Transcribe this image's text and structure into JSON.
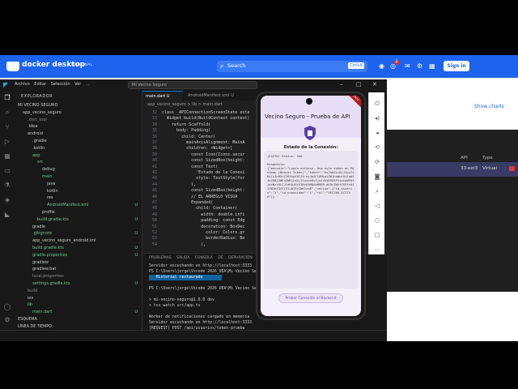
{
  "docker": {
    "title": "docker desktop",
    "badge": "PERSONAL",
    "search_placeholder": "Search",
    "search_shortcut": "Ctrl+K",
    "notification_count": "2",
    "signin_label": "Sign in",
    "show_charts": "Show charts",
    "device_columns": [
      "API",
      "Type"
    ],
    "device_row": {
      "api": "33-ext3",
      "type": "Virtual"
    }
  },
  "vscode": {
    "menu": [
      "Archivo",
      "Editar",
      "Selección",
      "Ver",
      "..."
    ],
    "search_text": "Mi Vecino Seguro",
    "explorer_title": "EXPLORADOR",
    "tree": [
      {
        "label": "MI VECINO SEGURO",
        "indent": 0,
        "badge": "",
        "color": "#cccccc"
      },
      {
        "label": "app_vecino_seguro",
        "indent": 1,
        "badge": "",
        "color": "#cccccc"
      },
      {
        "label": ".dart_tool",
        "indent": 2,
        "badge": "",
        "color": "#8a8a8a"
      },
      {
        "label": ".idea",
        "indent": 2,
        "badge": "",
        "color": "#cccccc"
      },
      {
        "label": "android",
        "indent": 2,
        "badge": "",
        "color": "#cccccc"
      },
      {
        "label": ".gradle",
        "indent": 3,
        "badge": "",
        "color": "#cccccc"
      },
      {
        "label": ".kotlin",
        "indent": 3,
        "badge": "",
        "color": "#cccccc"
      },
      {
        "label": "app",
        "indent": 3,
        "badge": "",
        "color": "#73c991"
      },
      {
        "label": "src",
        "indent": 4,
        "badge": "",
        "color": "#73c991"
      },
      {
        "label": "debug",
        "indent": 5,
        "badge": "",
        "color": "#cccccc"
      },
      {
        "label": "main",
        "indent": 5,
        "badge": "",
        "color": "#73c991"
      },
      {
        "label": "java",
        "indent": 6,
        "badge": "",
        "color": "#cccccc"
      },
      {
        "label": "kotlin",
        "indent": 6,
        "badge": "",
        "color": "#cccccc"
      },
      {
        "label": "res",
        "indent": 6,
        "badge": "",
        "color": "#cccccc"
      },
      {
        "label": "AndroidManifest.xml",
        "indent": 6,
        "badge": "U",
        "color": "#73c991"
      },
      {
        "label": "profile",
        "indent": 5,
        "badge": "",
        "color": "#cccccc"
      },
      {
        "label": "build.gradle.kts",
        "indent": 4,
        "badge": "U",
        "color": "#73c991"
      },
      {
        "label": "gradle",
        "indent": 3,
        "badge": "",
        "color": "#cccccc"
      },
      {
        "label": ".gitignore",
        "indent": 3,
        "badge": "U",
        "color": "#73c991"
      },
      {
        "label": "app_vecino_seguro_android.iml",
        "indent": 3,
        "badge": "",
        "color": "#cccccc"
      },
      {
        "label": "build.gradle.kts",
        "indent": 3,
        "badge": "U",
        "color": "#73c991"
      },
      {
        "label": "gradle.properties",
        "indent": 3,
        "badge": "U",
        "color": "#73c991"
      },
      {
        "label": "gradlew",
        "indent": 3,
        "badge": "",
        "color": "#cccccc"
      },
      {
        "label": "gradlew.bat",
        "indent": 3,
        "badge": "",
        "color": "#cccccc"
      },
      {
        "label": "local.properties",
        "indent": 3,
        "badge": "",
        "color": "#8a8a8a"
      },
      {
        "label": "settings.gradle.kts",
        "indent": 3,
        "badge": "U",
        "color": "#73c991"
      },
      {
        "label": "build",
        "indent": 2,
        "badge": "",
        "color": "#8a8a8a"
      },
      {
        "label": "ios",
        "indent": 2,
        "badge": "",
        "color": "#cccccc"
      },
      {
        "label": "lib",
        "indent": 2,
        "badge": "",
        "color": "#73c991"
      },
      {
        "label": "main.dart",
        "indent": 3,
        "badge": "U",
        "color": "#73c991"
      }
    ],
    "outline_label": "ESQUEMA",
    "timeline_label": "LÍNEA DE TIEMPO",
    "tabs": [
      {
        "label": "main.dart U",
        "active": true
      },
      {
        "label": "AndroidManifest.xml U",
        "active": false
      }
    ],
    "breadcrumb": "app_vecino_seguro > lib > main.dart",
    "code": [
      {
        "n": "32",
        "t": "class _APIConnectionScreenState exte"
      },
      {
        "n": "33",
        "t": "  Widget build(BuildContext context)"
      },
      {
        "n": "34",
        "t": "    return Scaffold("
      },
      {
        "n": "35",
        "t": "      body: Padding("
      },
      {
        "n": "36",
        "t": "        child: Center("
      },
      {
        "n": "37",
        "t": "          mainAxisAlignment: MainA"
      },
      {
        "n": "38",
        "t": "          children: <Widget>["
      },
      {
        "n": "39",
        "t": "            const Icon(Icons.secur"
      },
      {
        "n": "40",
        "t": "            const SizedBox(height:"
      },
      {
        "n": "41",
        "t": "            const Text("
      },
      {
        "n": "42",
        "t": "              'Estado de la Conexi"
      },
      {
        "n": "43",
        "t": "              style: TextStyle(for"
      },
      {
        "n": "44",
        "t": "            ),"
      },
      {
        "n": "45",
        "t": "            const SizedBox(height:"
      },
      {
        "n": "46",
        "t": "            // EL ARREGLO VISUA"
      },
      {
        "n": "47",
        "t": "            Expanded("
      },
      {
        "n": "48",
        "t": "              child: Container("
      },
      {
        "n": "49",
        "t": "                width: double.infi"
      },
      {
        "n": "50",
        "t": "                padding: const Edg"
      },
      {
        "n": "51",
        "t": "                decoration: BoxDec"
      },
      {
        "n": "52",
        "t": "                  color: Colors.gr"
      },
      {
        "n": "53",
        "t": "                  borderRadius: Bo"
      },
      {
        "n": "54",
        "t": "                ),"
      }
    ],
    "panel_tabs": [
      "PROBLEMAS",
      "SALIDA",
      "CONSOLA DE DEPURACIÓN",
      "TERMINAL"
    ],
    "terminal": [
      "Servidor escuchando en http://localhost:3333",
      "PS C:\\Users\\jorge\\Vscode 2026_UEA\\Mi Vecino Seg",
      "   Historial restaurado",
      "",
      "PS C:\\Users\\jorge\\Vscode 2026_UEA\\Mi Vecino Seg",
      "",
      "> mi-vecino-seguro@1.0.0 dev",
      "> tsx watch src/app.ts",
      "",
      "Worker de notificaciones cargado en memoria",
      "Servidor escuchando en http://localhost:3333",
      "[REQUEST] POST /api/usuarios/token-prueba"
    ]
  },
  "emulator": {
    "app_title": "Vecino Seguro - Prueba de API",
    "debug_banner": "DEBUG",
    "heading": "Estado de la Conexión:",
    "status_line": "¡ÉXITO! Status: 200",
    "response_label": "Respuesta:",
    "response_body": "{\"mensaje\":\"Login exitoso. Usa este token en Postman (Bearer Token)\",\"token\":\"eyJhbGciOiJIUzI1NiIsInR5cCI6IkpXVCJ9.eyJpZCI6MiwiZW1haWwiOiJqb3JnZUB1ZWEuZWR1LmVjIiwicm9sIjoiVkVDSU5PIiwiaWF0IjoxNzY0LCJleHAiOjE3NzE0MDAwMDB9.dG9rZW5fZGVfcHJ1ZWJhX3ZlY2lub19zZWd1cm8\",\"vecino\":{\"id_usuario\":\"2\",\"id_comunidad\":\"1\",\"rol\":\"VECINO_ACTIVO\"}}",
    "button_label": "Probar Conexión al Backend"
  }
}
